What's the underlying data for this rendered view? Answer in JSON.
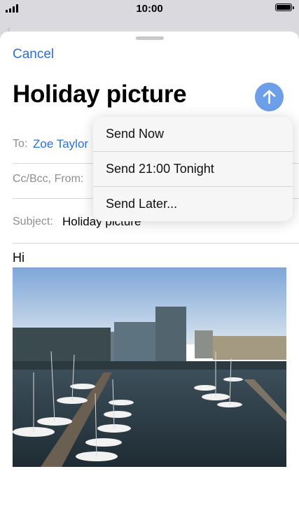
{
  "status_bar": {
    "time": "10:00"
  },
  "compose": {
    "cancel_label": "Cancel",
    "title": "Holiday picture",
    "to_label": "To:",
    "to_value": "Zoe Taylor",
    "cc_label": "Cc/Bcc, From:",
    "subject_label": "Subject:",
    "subject_value": "Holiday picture",
    "body_text": "Hi",
    "accent_color": "#2f6fd0",
    "send_button_color": "#6d9ee8"
  },
  "send_menu": {
    "items": [
      {
        "label": "Send Now"
      },
      {
        "label": "Send 21:00 Tonight"
      },
      {
        "label": "Send Later..."
      }
    ]
  },
  "icons": {
    "send": "arrow-up-icon",
    "back": "chevron-left-icon",
    "signal": "cellular-signal-icon",
    "battery": "battery-icon"
  }
}
